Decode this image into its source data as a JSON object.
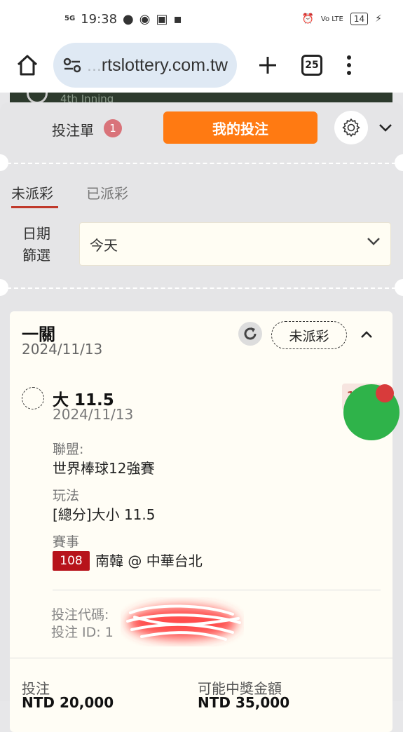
{
  "status_bar": {
    "network": "5G",
    "time": "19:38",
    "lte": "Vo LTE",
    "battery": "14"
  },
  "browser": {
    "url": "rtslottery.com.tw",
    "url_faded": "...",
    "tab_count": "25"
  },
  "background_game": {
    "inning": "4th Inning"
  },
  "slip": {
    "title": "投注單",
    "count": "1",
    "my_bets_label": "我的投注"
  },
  "tabs": [
    {
      "label": "未派彩",
      "active": true
    },
    {
      "label": "已派彩",
      "active": false
    }
  ],
  "date_filter": {
    "label_line1": "日期",
    "label_line2": "篩選",
    "selected": "今天"
  },
  "bet": {
    "type": "一關",
    "date": "2024/11/13",
    "status": "未派彩",
    "selection": {
      "name": "大 11.5",
      "date": "2024/11/13",
      "odds": "1.75",
      "league_label": "聯盟:",
      "league": "世界棒球12強賽",
      "market_label": "玩法",
      "market": "[總分]大小 11.5",
      "event_label": "賽事",
      "game_number": "108",
      "event": "南韓 @ 中華台北"
    },
    "code_label": "投注代碼:",
    "id_label": "投注 ID: 1",
    "stake_label": "投注",
    "stake_value": "NTD 20,000",
    "payout_label": "可能中獎金額",
    "payout_value": "NTD 35,000"
  },
  "colors": {
    "accent_orange": "#ff7a12",
    "tab_underline": "#c0392b",
    "game_badge": "#b7131b",
    "odds_text": "#b03a2e"
  }
}
